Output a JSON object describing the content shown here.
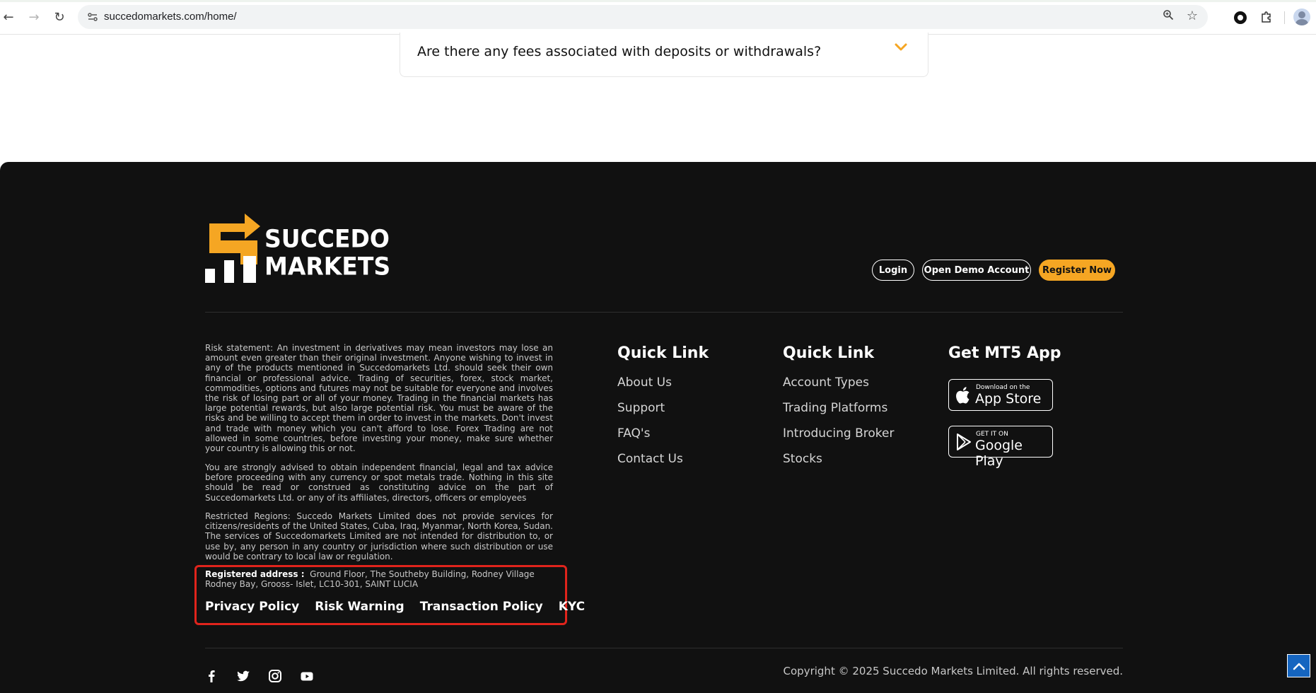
{
  "browser": {
    "url": "succedomarkets.com/home/",
    "nav": {
      "back": "←",
      "forward": "→",
      "reload": "↻"
    },
    "icons": [
      "site-settings-icon",
      "zoom-icon",
      "bookmark-star-icon",
      "extension-circle-icon",
      "puzzle-extensions-icon",
      "profile-avatar-icon"
    ]
  },
  "faq": {
    "question": "Are there any fees associated with deposits or withdrawals?",
    "accent": "#f5a623"
  },
  "footer": {
    "logo": {
      "line1": "SUCCEDO",
      "line2": "MARKETS"
    },
    "buttons": {
      "login": "Login",
      "demo": "Open Demo Account",
      "register": "Register Now"
    },
    "risk_statement": "Risk statement: An investment in derivatives may mean investors may lose an amount even greater than their original investment. Anyone wishing to invest in any of the products mentioned in Succedomarkets Ltd. should seek their own financial or professional advice. Trading of securities, forex, stock market, commodities, options and futures may not be suitable for everyone and involves the risk of losing part or all of your money. Trading in the financial markets has large potential rewards, but also large potential risk. You must be aware of the risks and be willing to accept them in order to invest in the markets. Don't invest and trade with money which you can't afford to lose. Forex Trading are not allowed in some countries, before investing your money, make sure whether your country is allowing this or not.",
    "advice": "You are strongly advised to obtain independent financial, legal and tax advice before proceeding with any currency or spot metals trade. Nothing in this site should be read or construed as constituting advice on the part of Succedomarkets Ltd. or any of its affiliates, directors, officers or employees",
    "restricted": "Restricted Regions: Succedo Markets Limited does not provide services for citizens/residents of the United States, Cuba, Iraq, Myanmar, North Korea, Sudan. The services of Succedomarkets Limited are not intended for distribution to, or use by, any person in any country or jurisdiction where such distribution or use would be contrary to local law or regulation.",
    "address_label": "Registered address :",
    "address_text": "Ground Floor, The Southeby Building, Rodney Village Rodney Bay, Grooss- Islet, LC10-301, SAINT LUCIA",
    "policy_links": [
      "Privacy Policy",
      "Risk Warning",
      "Transaction Policy",
      "KYC"
    ],
    "col1": {
      "title": "Quick Link",
      "links": [
        "About Us",
        "Support",
        "FAQ's",
        "Contact Us"
      ]
    },
    "col2": {
      "title": "Quick Link",
      "links": [
        "Account Types",
        "Trading Platforms",
        "Introducing Broker",
        "Stocks"
      ]
    },
    "col3": {
      "title": "Get MT5 App",
      "appstore": {
        "small": "Download on the",
        "big": "App Store"
      },
      "googleplay": {
        "small": "GET IT ON",
        "big": "Google Play"
      }
    },
    "social": [
      "facebook-icon",
      "twitter-icon",
      "instagram-icon",
      "youtube-icon"
    ],
    "copyright": "Copyright © 2025 Succedo Markets Limited. All rights reserved.",
    "colors": {
      "background": "#111111",
      "accent": "#f5a623",
      "highlight": "#e0241c",
      "scroll_top": "#1565c0"
    }
  }
}
